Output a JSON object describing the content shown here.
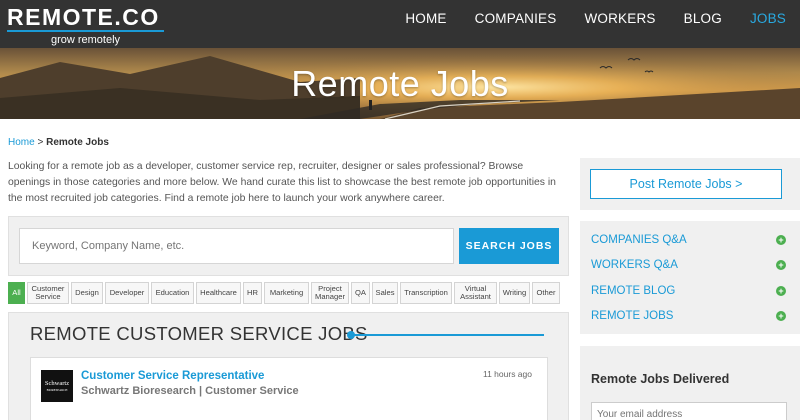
{
  "header": {
    "logo_title": "REMOTE.CO",
    "logo_tagline": "grow remotely",
    "nav": [
      "HOME",
      "COMPANIES",
      "WORKERS",
      "BLOG",
      "JOBS"
    ],
    "active_nav": "JOBS",
    "accent": "#1a9ad6"
  },
  "hero": {
    "title": "Remote Jobs"
  },
  "breadcrumb": {
    "home": "Home",
    "separator": " > ",
    "current": "Remote Jobs"
  },
  "intro": "Looking for a remote job as a developer, customer service rep, recruiter, designer or sales professional? Browse openings in those categories and more below. We hand curate this list to showcase the best remote job opportunities in the most recruited job categories. Find a remote job here to launch your work anywhere career.",
  "search": {
    "placeholder": "Keyword, Company Name, etc.",
    "button": "SEARCH JOBS"
  },
  "categories": [
    "All",
    "Customer Service",
    "Design",
    "Developer",
    "Education",
    "Healthcare",
    "HR",
    "Marketing",
    "Project Manager",
    "QA",
    "Sales",
    "Transcription",
    "Virtual Assistant",
    "Writing",
    "Other"
  ],
  "active_category": "All",
  "jobs_section": {
    "heading": "REMOTE CUSTOMER SERVICE JOBS",
    "jobs": [
      {
        "logo_text": "Schwartz",
        "logo_subtext": "BIORESEARCH",
        "title": "Customer Service Representative",
        "company_line": "Schwartz Bioresearch | Customer Service",
        "posted": "11 hours ago"
      }
    ]
  },
  "sidebar": {
    "post_button": "Post Remote Jobs >",
    "links": [
      "COMPANIES Q&A",
      "WORKERS Q&A",
      "REMOTE BLOG",
      "REMOTE JOBS"
    ],
    "plus_icon": "+",
    "delivered_title": "Remote Jobs Delivered",
    "email_placeholder": "Your email address"
  },
  "colors": {
    "header_bg": "#333333",
    "accent": "#1a9ad6",
    "green": "#4caf50",
    "panel_bg": "#f0f0f0"
  }
}
